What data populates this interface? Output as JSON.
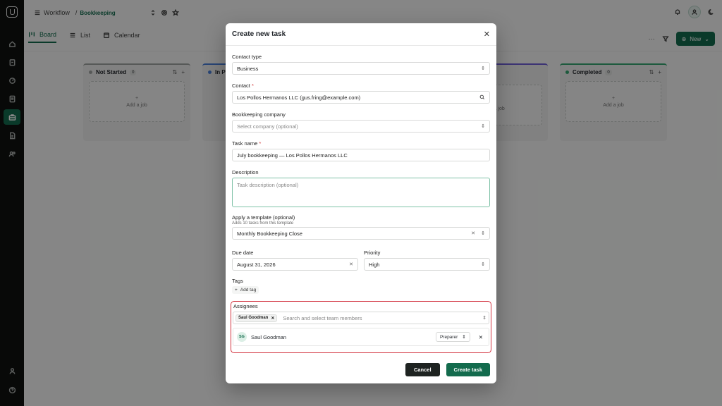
{
  "breadcrumb": {
    "section": "Workflow",
    "separator": "/",
    "page": "Bookkeeping"
  },
  "tabs": [
    {
      "label": "Board",
      "icon": "board-icon",
      "active": true
    },
    {
      "label": "List",
      "icon": "list-icon",
      "active": false
    },
    {
      "label": "Calendar",
      "icon": "calendar-icon",
      "active": false
    }
  ],
  "actions": {
    "more": "···",
    "new_label": "New"
  },
  "board": {
    "columns": [
      {
        "title": "Not Started",
        "count": "0",
        "add_label": "Add a job"
      },
      {
        "title": "In P",
        "count": "",
        "add_label": ""
      },
      {
        "title": "",
        "count": "",
        "add_label": "Add a job"
      },
      {
        "title": "Completed",
        "count": "0",
        "add_label": "Add a job"
      }
    ]
  },
  "modal": {
    "title": "Create new task",
    "contact_type": {
      "label": "Contact type",
      "value": "Business"
    },
    "contact": {
      "label": "Contact",
      "required": "*",
      "value": "Los Pollos Hermanos LLC (gus.fring@example.com)"
    },
    "company": {
      "label": "Bookkeeping company",
      "placeholder": "Select company (optional)"
    },
    "task_name": {
      "label": "Task name",
      "required": "*",
      "value": "July bookkeeping — Los Pollos Hermanos LLC"
    },
    "description": {
      "label": "Description",
      "placeholder": "Task description (optional)"
    },
    "template": {
      "label": "Apply a template (optional)",
      "hint": "Adds 10 tasks from this template",
      "value": "Monthly Bookkeeping Close"
    },
    "due_date": {
      "label": "Due date",
      "value": "August 31, 2026"
    },
    "priority": {
      "label": "Priority",
      "value": "High"
    },
    "tags": {
      "label": "Tags",
      "add_label": "Add tag"
    },
    "assignees": {
      "label": "Assignees",
      "chip": "Saul Goodman",
      "search_placeholder": "Search and select team members",
      "rows": [
        {
          "initials": "SG",
          "name": "Saul Goodman",
          "role": "Preparer"
        }
      ]
    },
    "cancel_label": "Cancel",
    "create_label": "Create task"
  },
  "colors": {
    "accent": "#136b4d",
    "highlight": "#d22f3c"
  }
}
